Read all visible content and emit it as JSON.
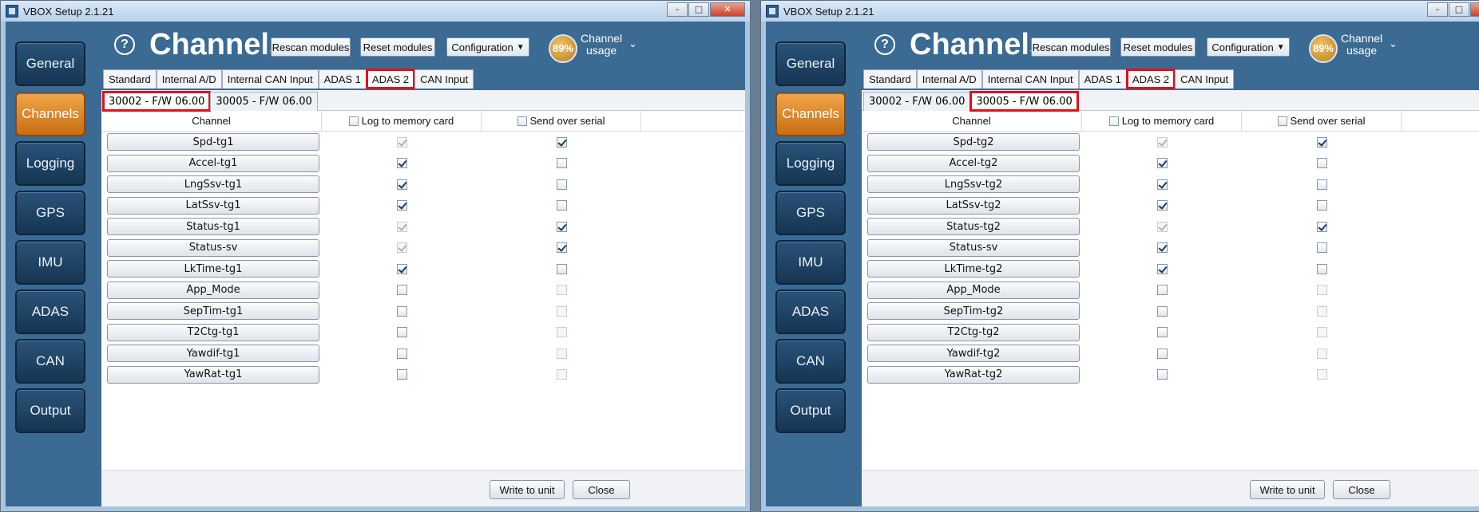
{
  "windows": [
    {
      "title": "VBOX Setup 2.1.21",
      "nav": [
        "General",
        "Channels",
        "Logging",
        "GPS",
        "IMU",
        "ADAS",
        "CAN",
        "Output"
      ],
      "active_nav": 1,
      "page_title": "Channels",
      "header_buttons": {
        "rescan": "Rescan modules",
        "reset": "Reset modules",
        "configuration": "Configuration"
      },
      "usage_percent": "89%",
      "usage_label_1": "Channel",
      "usage_label_2": "usage",
      "tabs": [
        "Standard",
        "Internal A/D",
        "Internal CAN Input",
        "ADAS 1",
        "ADAS 2",
        "CAN Input"
      ],
      "active_tab": 4,
      "subtabs": [
        "30002 - F/W 06.00",
        "30005 - F/W 06.00"
      ],
      "active_subtab": 0,
      "columns": {
        "channel": "Channel",
        "log": "Log to memory card",
        "serial": "Send over serial"
      },
      "rows": [
        {
          "name": "Spd-tg1",
          "log": "checked-disabled",
          "serial": "checked"
        },
        {
          "name": "Accel-tg1",
          "log": "checked",
          "serial": "unchecked"
        },
        {
          "name": "LngSsv-tg1",
          "log": "checked",
          "serial": "unchecked"
        },
        {
          "name": "LatSsv-tg1",
          "log": "checked",
          "serial": "unchecked"
        },
        {
          "name": "Status-tg1",
          "log": "checked-disabled",
          "serial": "checked"
        },
        {
          "name": "Status-sv",
          "log": "checked-disabled",
          "serial": "checked"
        },
        {
          "name": "LkTime-tg1",
          "log": "checked",
          "serial": "unchecked"
        },
        {
          "name": "App_Mode",
          "log": "unchecked",
          "serial": "disabled"
        },
        {
          "name": "SepTim-tg1",
          "log": "unchecked",
          "serial": "disabled"
        },
        {
          "name": "T2Ctg-tg1",
          "log": "unchecked",
          "serial": "disabled"
        },
        {
          "name": "Yawdif-tg1",
          "log": "unchecked",
          "serial": "disabled"
        },
        {
          "name": "YawRat-tg1",
          "log": "unchecked",
          "serial": "disabled"
        }
      ],
      "footer": {
        "write": "Write to unit",
        "close": "Close"
      }
    },
    {
      "title": "VBOX Setup 2.1.21",
      "nav": [
        "General",
        "Channels",
        "Logging",
        "GPS",
        "IMU",
        "ADAS",
        "CAN",
        "Output"
      ],
      "active_nav": 1,
      "page_title": "Channels",
      "header_buttons": {
        "rescan": "Rescan modules",
        "reset": "Reset modules",
        "configuration": "Configuration"
      },
      "usage_percent": "89%",
      "usage_label_1": "Channel",
      "usage_label_2": "usage",
      "tabs": [
        "Standard",
        "Internal A/D",
        "Internal CAN Input",
        "ADAS 1",
        "ADAS 2",
        "CAN Input"
      ],
      "active_tab": 4,
      "subtabs": [
        "30002 - F/W 06.00",
        "30005 - F/W 06.00"
      ],
      "active_subtab": 1,
      "columns": {
        "channel": "Channel",
        "log": "Log to memory card",
        "serial": "Send over serial"
      },
      "rows": [
        {
          "name": "Spd-tg2",
          "log": "checked-disabled",
          "serial": "checked"
        },
        {
          "name": "Accel-tg2",
          "log": "checked",
          "serial": "unchecked"
        },
        {
          "name": "LngSsv-tg2",
          "log": "checked",
          "serial": "unchecked"
        },
        {
          "name": "LatSsv-tg2",
          "log": "checked",
          "serial": "unchecked"
        },
        {
          "name": "Status-tg2",
          "log": "checked-disabled",
          "serial": "checked"
        },
        {
          "name": "Status-sv",
          "log": "checked",
          "serial": "unchecked"
        },
        {
          "name": "LkTime-tg2",
          "log": "checked",
          "serial": "unchecked"
        },
        {
          "name": "App_Mode",
          "log": "unchecked",
          "serial": "disabled"
        },
        {
          "name": "SepTim-tg2",
          "log": "unchecked",
          "serial": "disabled"
        },
        {
          "name": "T2Ctg-tg2",
          "log": "unchecked",
          "serial": "disabled"
        },
        {
          "name": "Yawdif-tg2",
          "log": "unchecked",
          "serial": "disabled"
        },
        {
          "name": "YawRat-tg2",
          "log": "unchecked",
          "serial": "disabled"
        }
      ],
      "footer": {
        "write": "Write to unit",
        "close": "Close"
      }
    }
  ]
}
